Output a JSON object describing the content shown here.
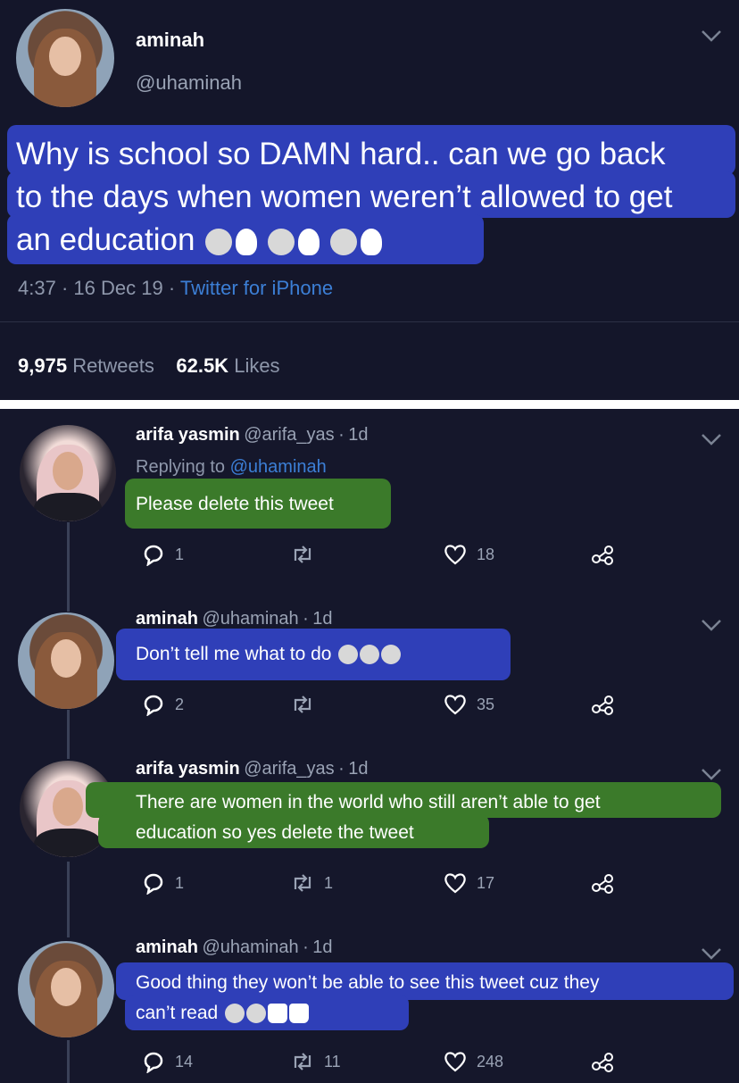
{
  "main_tweet": {
    "author_name": "aminah",
    "author_handle": "@uhaminah",
    "text": "Why is school so DAMN hard.. can we go back to the days when women weren’t allowed to get an education",
    "text_lines": [
      "Why is school so DAMN hard.. can we go back",
      "to the days when women weren’t allowed to get",
      "an education"
    ],
    "time": "4:37",
    "date": "16 Dec 19",
    "source": "Twitter for iPhone",
    "retweets_count": "9,975",
    "retweets_label": "Retweets",
    "likes_count": "62.5K",
    "likes_label": "Likes",
    "dot": "·"
  },
  "replies": [
    {
      "name": "arifa yasmin",
      "handle": "@arifa_yas",
      "age": "1d",
      "replying_label": "Replying to",
      "replying_to": "@uhaminah",
      "text_lines": [
        "Please delete this tweet"
      ],
      "reply_count": "1",
      "retweet_count": "",
      "like_count": "18"
    },
    {
      "name": "aminah",
      "handle": "@uhaminah",
      "age": "1d",
      "text_lines": [
        "Don’t tell me what to do"
      ],
      "reply_count": "2",
      "retweet_count": "",
      "like_count": "35"
    },
    {
      "name": "arifa yasmin",
      "handle": "@arifa_yas",
      "age": "1d",
      "text_lines": [
        "There are women in the world who still aren’t able to get",
        "education so yes delete the tweet"
      ],
      "reply_count": "1",
      "retweet_count": "1",
      "like_count": "17"
    },
    {
      "name": "aminah",
      "handle": "@uhaminah",
      "age": "1d",
      "text_lines": [
        "Good thing they won’t be able to see this tweet cuz they",
        "can’t read"
      ],
      "reply_count": "14",
      "retweet_count": "11",
      "like_count": "248"
    }
  ],
  "icons": {
    "chevron": "chevron-down-icon",
    "reply": "reply-icon",
    "retweet": "retweet-icon",
    "like": "heart-icon",
    "share": "share-icon"
  },
  "colors": {
    "background": "#15172b",
    "blue_highlight": "#2f3fb8",
    "green_highlight": "#3b7a2a",
    "link": "#3c7fd6"
  }
}
